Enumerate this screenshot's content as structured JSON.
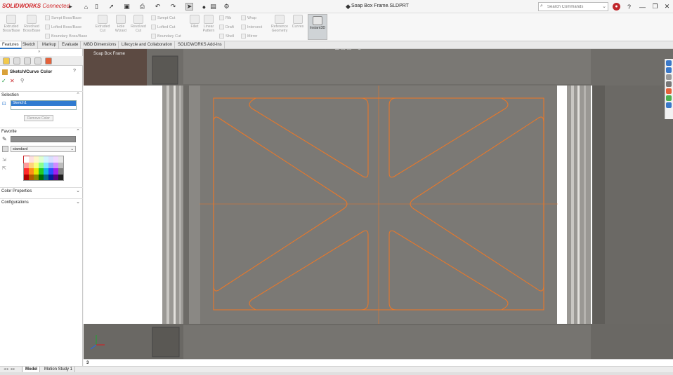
{
  "app": {
    "brand": "SOLIDWORKS",
    "brand_suffix": " Connected",
    "doc_title": "Soap Box Frame.SLDPRT"
  },
  "search": {
    "placeholder": "Search Commands"
  },
  "ribbon": {
    "features_col1": [
      {
        "label": "Extruded\nBoss/Base",
        "icon": "extrude-boss-icon"
      },
      {
        "label": "Revolved\nBoss/Base",
        "icon": "revolve-boss-icon"
      }
    ],
    "features_rows": [
      "Swept Boss/Base",
      "Lofted Boss/Base",
      "Boundary Boss/Base"
    ],
    "cut_col": [
      {
        "label": "Extruded\nCut",
        "icon": "extruded-cut-icon"
      },
      {
        "label": "Hole\nWizard",
        "icon": "hole-wizard-icon"
      },
      {
        "label": "Revolved\nCut",
        "icon": "revolved-cut-icon"
      }
    ],
    "cut_rows": [
      "Swept Cut",
      "Lofted Cut",
      "Boundary Cut"
    ],
    "modify_col": [
      {
        "label": "Fillet",
        "icon": "fillet-icon"
      },
      {
        "label": "Linear\nPattern",
        "icon": "linear-pattern-icon"
      }
    ],
    "modify_rows_a": [
      "Rib",
      "Draft",
      "Shell"
    ],
    "modify_rows_b": [
      "Wrap",
      "Intersect",
      "Mirror"
    ],
    "ref_col": [
      {
        "label": "Reference\nGeometry",
        "icon": "reference-geometry-icon"
      },
      {
        "label": "Curves",
        "icon": "curves-icon"
      }
    ],
    "instant3d": "Instant3D"
  },
  "tabs": [
    "Features",
    "Sketch",
    "Markup",
    "Evaluate",
    "MBD Dimensions",
    "Lifecycle and Collaboration",
    "SOLIDWORKS Add-Ins"
  ],
  "panel": {
    "title": "Sketch/Curve Color",
    "selection_label": "Selection",
    "selected_item": "Sketch1",
    "remove_button": "Remove Color",
    "favorite_label": "Favorite",
    "standard_option": "standard",
    "color_properties": "Color Properties",
    "configurations": "Configurations"
  },
  "viewport": {
    "tree_label": "Soap Box Frame"
  },
  "status": {
    "number": "3"
  },
  "bottom_tabs": [
    "Model",
    "Motion Study 1"
  ],
  "colors": {
    "sketch_orange": "#e8782a",
    "accent_blue": "#2f7bd0",
    "brand_red": "#d0262a"
  }
}
